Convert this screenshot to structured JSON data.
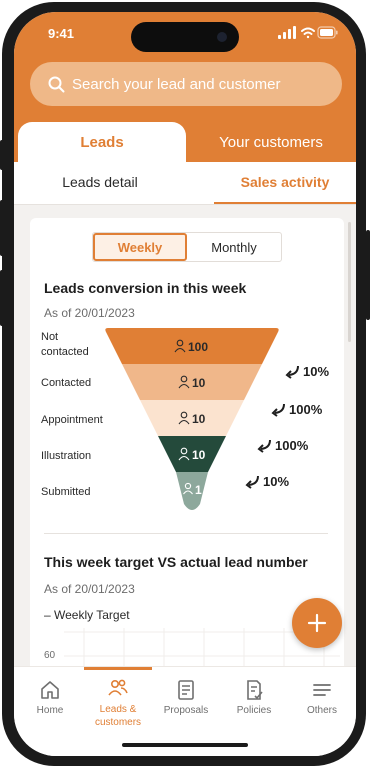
{
  "status_bar": {
    "time": "9:41"
  },
  "search": {
    "placeholder": "Search your lead and customer"
  },
  "top_tabs": [
    {
      "label": "Leads",
      "active": true
    },
    {
      "label": "Your customers",
      "active": false
    }
  ],
  "sub_tabs": [
    {
      "label": "Leads detail",
      "active": false
    },
    {
      "label": "Sales activity",
      "active": true
    }
  ],
  "period_toggle": {
    "options": [
      "Weekly",
      "Monthly"
    ],
    "selected": "Weekly"
  },
  "conversion": {
    "title": "Leads conversion in this week",
    "as_of": "As of 20/01/2023",
    "stages": [
      {
        "label": "Not contacted",
        "count": "100"
      },
      {
        "label": "Contacted",
        "count": "10"
      },
      {
        "label": "Appointment",
        "count": "10"
      },
      {
        "label": "Illustration",
        "count": "10"
      },
      {
        "label": "Submitted",
        "count": "1"
      }
    ],
    "rates": [
      "10%",
      "100%",
      "100%",
      "10%"
    ]
  },
  "target": {
    "title": "This week target VS actual lead number",
    "as_of": "As of 20/01/2023",
    "legend": "Weekly Target",
    "y_tick": "60"
  },
  "bottom_nav": [
    {
      "label": "Home",
      "icon": "home-icon"
    },
    {
      "label": "Leads & customers",
      "icon": "people-icon",
      "active": true
    },
    {
      "label": "Proposals",
      "icon": "document-icon"
    },
    {
      "label": "Policies",
      "icon": "policy-icon"
    },
    {
      "label": "Others",
      "icon": "menu-icon"
    }
  ],
  "colors": {
    "accent": "#e07f35",
    "stage_colors": [
      "#e07f35",
      "#f0b78a",
      "#fbe3cf",
      "#244a3b",
      "#8da89c"
    ]
  }
}
